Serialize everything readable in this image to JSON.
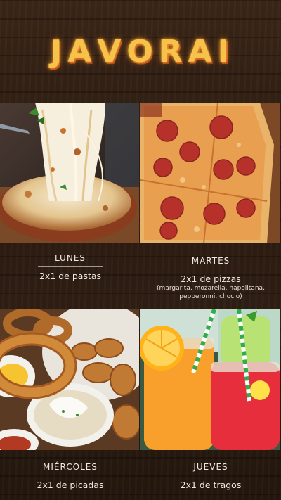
{
  "brand": {
    "letters": [
      "J",
      "A",
      "V",
      "O",
      "R",
      "A",
      "I"
    ]
  },
  "days": [
    {
      "day": "LUNES",
      "offer": "2x1 de pastas",
      "detail_lines": []
    },
    {
      "day": "MARTES",
      "offer": "2x1 de pizzas",
      "detail_lines": [
        "(margarita, mozarella, napolitana,",
        "pepperonni, choclo)"
      ]
    },
    {
      "day": "MIÉRCOLES",
      "offer": "2x1 de picadas",
      "detail_lines": []
    },
    {
      "day": "JUEVES",
      "offer": "2x1 de tragos",
      "detail_lines": []
    }
  ],
  "colors": {
    "wood": "#2e1e13",
    "marquee": "#f6c24a",
    "text": "#f1e9e2"
  }
}
